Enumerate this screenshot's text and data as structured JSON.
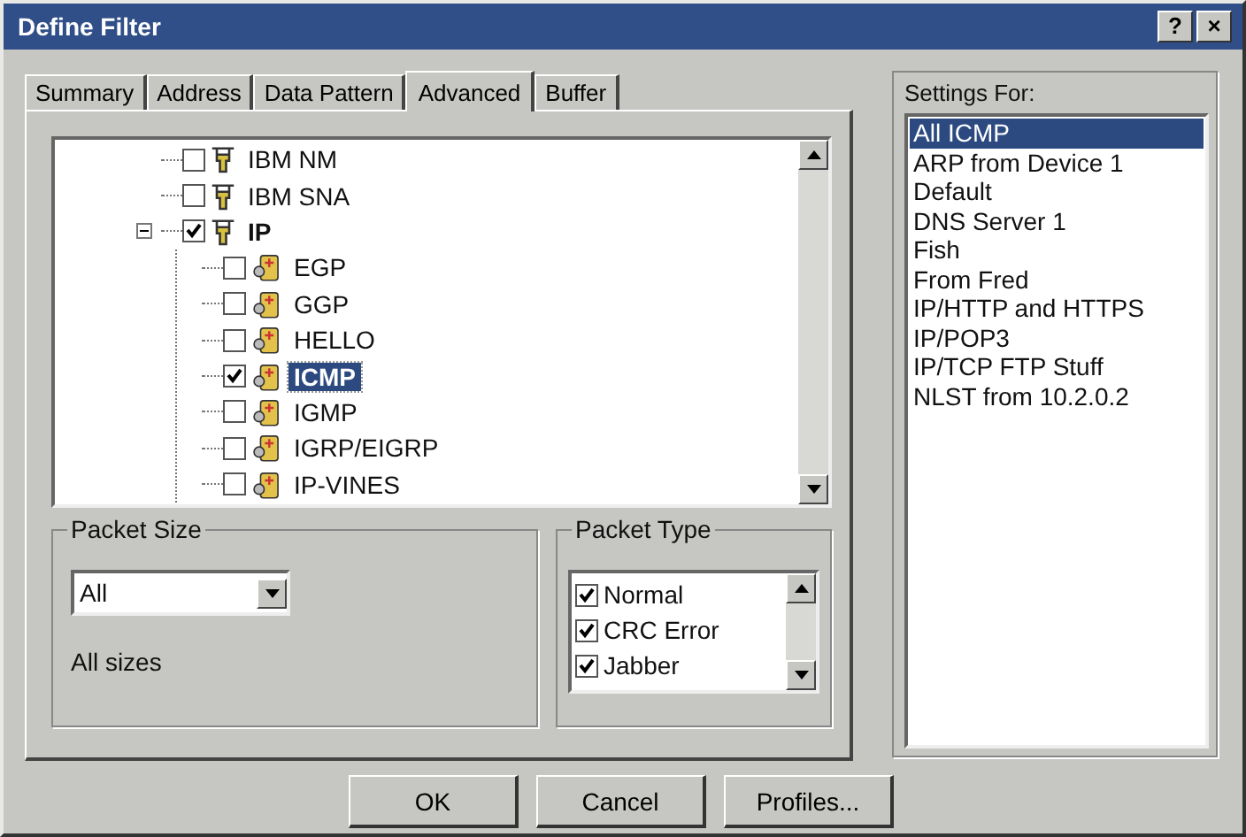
{
  "window": {
    "title": "Define Filter",
    "help_button": "?",
    "close_button": "×"
  },
  "tabs": [
    {
      "label": "Summary",
      "selected": false
    },
    {
      "label": "Address",
      "selected": false
    },
    {
      "label": "Data Pattern",
      "selected": false
    },
    {
      "label": "Advanced",
      "selected": true
    },
    {
      "label": "Buffer",
      "selected": false
    }
  ],
  "tree": [
    {
      "label": "IBM NM",
      "checked": false,
      "selected": false
    },
    {
      "label": "IBM SNA",
      "checked": false,
      "selected": false
    },
    {
      "label": "IP",
      "checked": true,
      "selected": false,
      "expanded": true,
      "children": [
        {
          "label": "EGP",
          "checked": false,
          "selected": false
        },
        {
          "label": "GGP",
          "checked": false,
          "selected": false
        },
        {
          "label": "HELLO",
          "checked": false,
          "selected": false
        },
        {
          "label": "ICMP",
          "checked": true,
          "selected": true
        },
        {
          "label": "IGMP",
          "checked": false,
          "selected": false
        },
        {
          "label": "IGRP/EIGRP",
          "checked": false,
          "selected": false
        },
        {
          "label": "IP-VINES",
          "checked": false,
          "selected": false
        }
      ]
    }
  ],
  "packet_size": {
    "title": "Packet Size",
    "value": "All",
    "description": "All sizes"
  },
  "packet_type": {
    "title": "Packet Type",
    "items": [
      {
        "label": "Normal",
        "checked": true
      },
      {
        "label": "CRC Error",
        "checked": true
      },
      {
        "label": "Jabber",
        "checked": true
      }
    ]
  },
  "settings_for": {
    "title": "Settings For:",
    "items": [
      {
        "label": "All ICMP",
        "selected": true
      },
      {
        "label": "ARP from Device 1",
        "selected": false
      },
      {
        "label": "Default",
        "selected": false
      },
      {
        "label": "DNS Server 1",
        "selected": false
      },
      {
        "label": "Fish",
        "selected": false
      },
      {
        "label": "From Fred",
        "selected": false
      },
      {
        "label": "IP/HTTP and HTTPS",
        "selected": false
      },
      {
        "label": "IP/POP3",
        "selected": false
      },
      {
        "label": "IP/TCP FTP Stuff",
        "selected": false
      },
      {
        "label": "NLST from 10.2.0.2",
        "selected": false
      }
    ]
  },
  "buttons": [
    "OK",
    "Cancel",
    "Profiles..."
  ]
}
